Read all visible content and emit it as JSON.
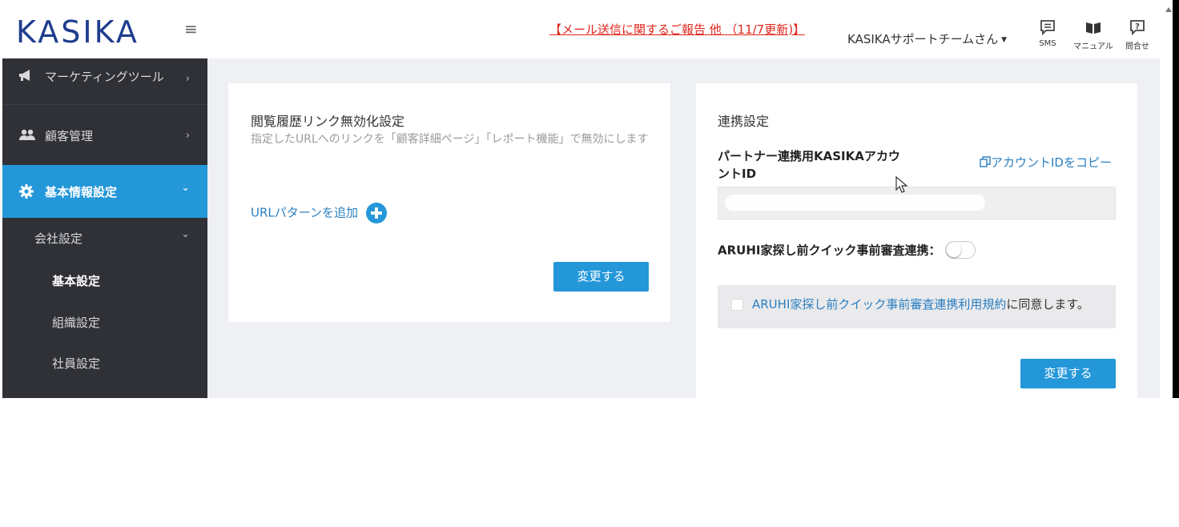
{
  "header": {
    "logo": "KASIKA",
    "menu_icon": "≡",
    "notice": "【メール送信に関するご報告 他 （11/7更新)】",
    "user": "KASIKAサポートチームさん",
    "icons": [
      {
        "name": "sms",
        "label": "SMS"
      },
      {
        "name": "manual",
        "label": "マニュアル"
      },
      {
        "name": "inquiry",
        "label": "問合せ"
      }
    ]
  },
  "sidebar": {
    "items": [
      {
        "label": "マーケティングツール",
        "chevron": "›"
      },
      {
        "label": "顧客管理",
        "chevron": "›"
      },
      {
        "label": "基本情報設定",
        "chevron": "⌄"
      },
      {
        "label": "会社設定",
        "chevron": "⌄"
      },
      {
        "label": "基本設定"
      },
      {
        "label": "組織設定"
      },
      {
        "label": "社員設定"
      }
    ]
  },
  "history_card": {
    "title": "閲覧履歴リンク無効化設定",
    "description": "指定したURLへのリンクを「顧客詳細ページ」「レポート機能」で無効にします",
    "add_pattern": "URLパターンを追加",
    "submit": "変更する"
  },
  "link_card": {
    "title": "連携設定",
    "account_id_label": "パートナー連携用KASIKAアカウントID",
    "copy_link": "アカウントIDをコピー",
    "aruhi_label": "ARUHI家探し前クイック事前審査連携：",
    "aruhi_enabled": false,
    "agree_link": "ARUHI家探し前クイック事前審査連携利用規約",
    "agree_suffix": "に同意します。",
    "agree_checked": false,
    "submit": "変更する"
  },
  "colors": {
    "primary": "#2497d9",
    "logo": "#1f3d8f",
    "notice": "#e0241b",
    "sidebar": "#2f3137"
  }
}
